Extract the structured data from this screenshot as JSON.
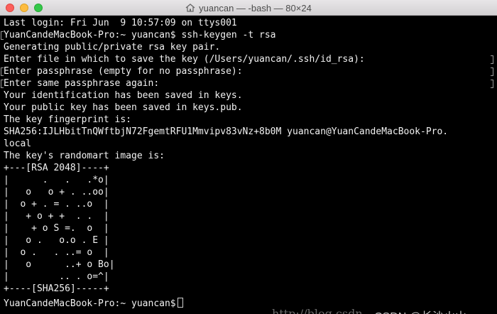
{
  "window": {
    "title": "yuancan — -bash — 80×24",
    "title_icon": "home-icon"
  },
  "terminal": {
    "lines": [
      "Last login: Fri Jun  9 10:57:09 on ttys001",
      "YuanCandeMacBook-Pro:~ yuancan$ ssh-keygen -t rsa",
      "Generating public/private rsa key pair.",
      "Enter file in which to save the key (/Users/yuancan/.ssh/id_rsa):",
      "Enter passphrase (empty for no passphrase):",
      "Enter same passphrase again:",
      "Your identification has been saved in keys.",
      "Your public key has been saved in keys.pub.",
      "The key fingerprint is:",
      "SHA256:IJLHbitTnQWftbjN72FgemtRFU1Mmvipv83vNz+8b0M yuancan@YuanCandeMacBook-Pro.",
      "local",
      "The key's randomart image is:",
      "+---[RSA 2048]----+",
      "|      .   .   .*o|",
      "|   o   o + . ..oo|",
      "|  o + . = . ..o  |",
      "|   + o + +  . .  |",
      "|    + o S =.  o  |",
      "|   o .   o.o . E |",
      "|  o .   . ..= o  |",
      "|   o      ..+ o Bo|",
      "|         .. . o=^|",
      "+----[SHA256]-----+",
      "YuanCandeMacBook-Pro:~ yuancan$"
    ]
  },
  "watermark": {
    "url_text": "http://blog.csdn",
    "brand_text": "CSDN @长沙火山"
  }
}
